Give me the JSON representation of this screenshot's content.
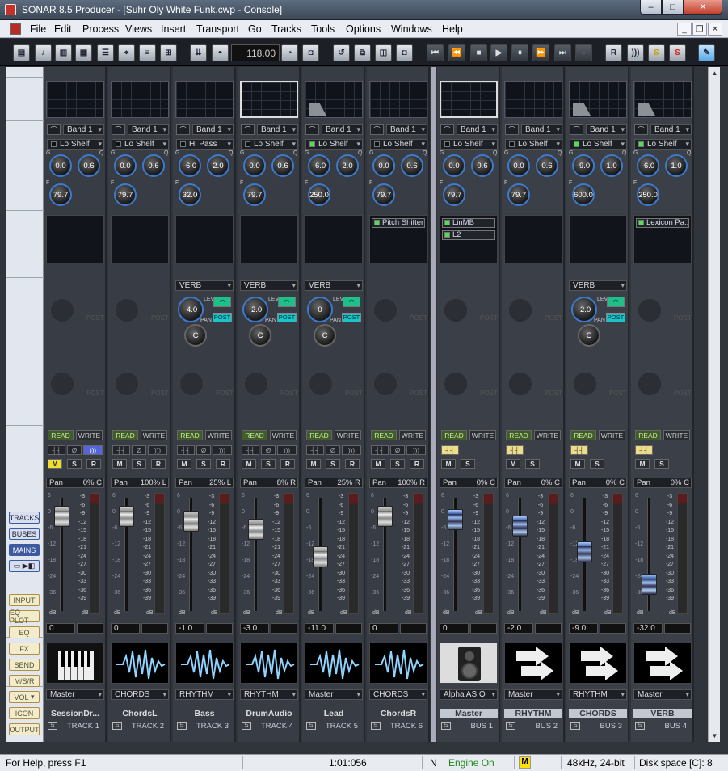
{
  "window": {
    "title": "SONAR 8.5 Producer - [Suhr Oly White Funk.cwp - Console]",
    "min_label": "–",
    "max_label": "□",
    "close_label": "✕"
  },
  "menu": [
    "File",
    "Edit",
    "Process",
    "Views",
    "Insert",
    "Transport",
    "Go",
    "Tracks",
    "Tools",
    "Options",
    "Windows",
    "Help"
  ],
  "mdi": {
    "min": "_",
    "restore": "❐",
    "close": "✕"
  },
  "toolbar": {
    "tempo": "118.00",
    "icons": [
      "tracks-view-icon",
      "piano-roll-icon",
      "staff-icon",
      "console-icon",
      "event-list-icon",
      "loop-icon",
      "lyrics-icon",
      "synth-rack-icon",
      "tempo-dropdown-icon",
      "metronome-icon",
      "tempo-icon",
      "record-options-icon",
      "loop-toggle-icon",
      "punch-icon",
      "snapshot-icon",
      "auto-rec-icon",
      "go-start-icon",
      "rewind-icon",
      "stop-icon",
      "play-icon",
      "pause-icon",
      "fast-forward-icon",
      "go-end-icon",
      "record-icon",
      "r-toggle-icon",
      "audio-engine-icon",
      "solo-icon",
      "mute-icon"
    ]
  },
  "side_labels": {
    "nav": [
      "TRACKS",
      "BUSES",
      "MAINS"
    ],
    "nav_active": "MAINS",
    "sections": [
      "INPUT",
      "EQ PLOT",
      "EQ",
      "FX",
      "SEND",
      "M/S/R",
      "VOL",
      "ICON",
      "OUTPUT"
    ]
  },
  "strips": [
    {
      "name": "SessionDr...",
      "number": "TRACK 1",
      "band": "Band 1",
      "filter": "Lo Shelf",
      "g": "0.0",
      "q": "0.6",
      "f": "79.7",
      "fx": [],
      "send": null,
      "pan_value": "0% C",
      "gain": "0",
      "output": "Master",
      "icon": "piano",
      "msr": [
        "M",
        "S",
        "R"
      ],
      "m_on": true,
      "bus": false,
      "filter_on": false
    },
    {
      "name": "ChordsL",
      "number": "TRACK 2",
      "band": "Band 1",
      "filter": "Lo Shelf",
      "g": "0.0",
      "q": "0.6",
      "f": "79.7",
      "fx": [],
      "send": null,
      "pan_value": "100% L",
      "gain": "0",
      "output": "CHORDS",
      "icon": "wave",
      "msr": [
        "M",
        "S",
        "R"
      ],
      "m_on": false,
      "bus": false,
      "filter_on": false
    },
    {
      "name": "Bass",
      "number": "TRACK 3",
      "band": "Band 1",
      "filter": "Hi Pass",
      "g": "-6.0",
      "q": "2.0",
      "f": "32.0",
      "fx": [],
      "send": {
        "name": "VERB",
        "lev": "-4.0",
        "pan": "C"
      },
      "pan_value": "25% L",
      "gain": "-1.0",
      "output": "RHYTHM",
      "icon": "wave",
      "msr": [
        "M",
        "S",
        "R"
      ],
      "m_on": false,
      "bus": false,
      "filter_on": false
    },
    {
      "name": "DrumAudio",
      "number": "TRACK 4",
      "band": "Band 1",
      "filter": "Lo Shelf",
      "g": "0.0",
      "q": "0.6",
      "f": "79.7",
      "fx": [],
      "send": {
        "name": "VERB",
        "lev": "-2.0",
        "pan": "C"
      },
      "pan_value": "8% R",
      "gain": "-3.0",
      "output": "RHYTHM",
      "icon": "wave",
      "msr": [
        "M",
        "S",
        "R"
      ],
      "m_on": false,
      "bus": false,
      "filter_on": false
    },
    {
      "name": "Lead",
      "number": "TRACK 5",
      "band": "Band 1",
      "filter": "Lo Shelf",
      "g": "-6.0",
      "q": "2.0",
      "f": "250.0",
      "fx": [],
      "send": {
        "name": "VERB",
        "lev": "0",
        "pan": "C"
      },
      "pan_value": "25% R",
      "gain": "-11.0",
      "output": "Master",
      "icon": "wave",
      "msr": [
        "M",
        "S",
        "R"
      ],
      "m_on": false,
      "bus": false,
      "filter_on": true
    },
    {
      "name": "ChordsR",
      "number": "TRACK 6",
      "band": "Band 1",
      "filter": "Lo Shelf",
      "g": "0.0",
      "q": "0.6",
      "f": "79.7",
      "fx": [
        "Pitch Shifter"
      ],
      "send": null,
      "pan_value": "100% R",
      "gain": "0",
      "output": "CHORDS",
      "icon": "wave",
      "msr": [
        "M",
        "S",
        "R"
      ],
      "m_on": false,
      "bus": false,
      "filter_on": false
    },
    {
      "name": "Master",
      "number": "BUS 1",
      "band": "Band 1",
      "filter": "Lo Shelf",
      "g": "0.0",
      "q": "0.6",
      "f": "79.7",
      "fx": [
        "LinMB",
        "L2"
      ],
      "send": null,
      "pan_value": "0% C",
      "gain": "0",
      "output": "Alpha ASIO",
      "icon": "speaker",
      "msr": [
        "M",
        "S"
      ],
      "m_on": false,
      "bus": true,
      "filter_on": false
    },
    {
      "name": "RHYTHM",
      "number": "BUS 2",
      "band": "Band 1",
      "filter": "Lo Shelf",
      "g": "0.0",
      "q": "0.6",
      "f": "79.7",
      "fx": [],
      "send": null,
      "pan_value": "0% C",
      "gain": "-2.0",
      "output": "Master",
      "icon": "arrows",
      "msr": [
        "M",
        "S"
      ],
      "m_on": false,
      "bus": true,
      "filter_on": false
    },
    {
      "name": "CHORDS",
      "number": "BUS 3",
      "band": "Band 1",
      "filter": "Lo Shelf",
      "g": "-9.0",
      "q": "1.0",
      "f": "600.0",
      "fx": [],
      "send": {
        "name": "VERB",
        "lev": "-2.0",
        "pan": "C"
      },
      "pan_value": "0% C",
      "gain": "-9.0",
      "output": "RHYTHM",
      "icon": "arrows",
      "msr": [
        "M",
        "S"
      ],
      "m_on": false,
      "bus": true,
      "filter_on": true
    },
    {
      "name": "VERB",
      "number": "BUS 4",
      "band": "Band 1",
      "filter": "Lo Shelf",
      "g": "-6.0",
      "q": "1.0",
      "f": "250.0",
      "fx": [
        "Lexicon Pa..."
      ],
      "send": null,
      "pan_value": "0% C",
      "gain": "-32.0",
      "output": "Master",
      "icon": "arrows",
      "msr": [
        "M",
        "S"
      ],
      "m_on": false,
      "bus": true,
      "filter_on": true
    }
  ],
  "labels": {
    "read": "READ",
    "write": "WRITE",
    "pan": "Pan",
    "lev": "LEV",
    "pan_knob": "PAN",
    "post": "POST",
    "db": "dB"
  },
  "fader_scale": [
    "6",
    "0",
    "-6",
    "-12",
    "-18",
    "-24",
    "-36"
  ],
  "meter_scale": [
    "-3",
    "-6",
    "-9",
    "-12",
    "-15",
    "-18",
    "-21",
    "-24",
    "-27",
    "-30",
    "-33",
    "-36",
    "-39"
  ],
  "status": {
    "help": "For Help, press F1",
    "time": "1:01:056",
    "n": "N",
    "engine": "Engine On",
    "m": "M",
    "format": "48kHz, 24-bit",
    "disk": "Disk space [C]: 8"
  }
}
